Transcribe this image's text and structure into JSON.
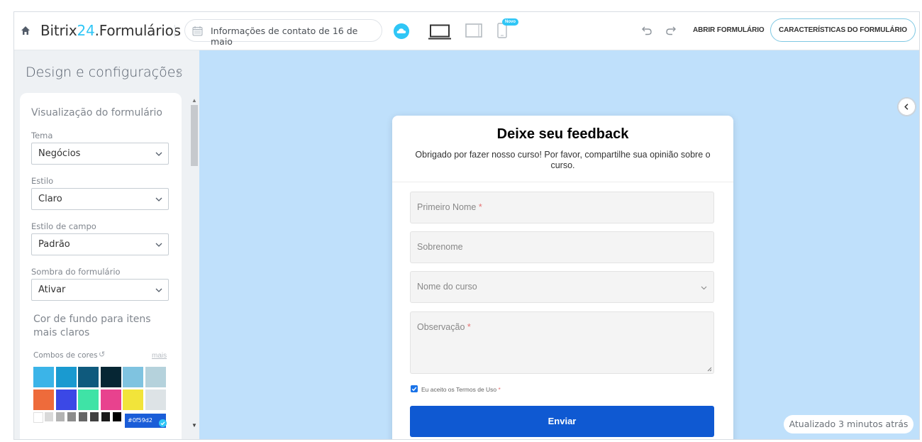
{
  "app": {
    "brand_name": "Bitrix",
    "brand_number": "24",
    "brand_suffix": ".Formulários",
    "accent_color": "#2fc6f6"
  },
  "toolbar": {
    "form_name": "Informações de contato de 16 de maio",
    "new_badge": "Novo",
    "open_form_label": "ABRIR FORMULÁRIO",
    "features_label": "CARACTERÍSTICAS DO FORMULÁRIO",
    "icons": [
      "home-icon",
      "calendar-icon",
      "cloud-icon",
      "desktop-icon",
      "tablet-icon",
      "mobile-icon",
      "undo-icon",
      "redo-icon"
    ]
  },
  "panel": {
    "title": "Design e configurações",
    "close_symbol": "×",
    "preview_heading": "Visualização do formulário",
    "fields": [
      {
        "label": "Tema",
        "value": "Negócios"
      },
      {
        "label": "Estilo",
        "value": "Claro"
      },
      {
        "label": "Estilo de campo",
        "value": "Padrão"
      },
      {
        "label": "Sombra do formulário",
        "value": "Ativar"
      }
    ],
    "background_color_label": "Cor de fundo para itens mais claros",
    "combos_label": "Combos de cores",
    "more_label": "mais",
    "swatches": [
      "#3bb4e8",
      "#1a9ad0",
      "#0f5a7d",
      "#062634",
      "#7fc3e0",
      "#b5d2dc",
      "#ee6b3b",
      "#3b48e6",
      "#3fe3a6",
      "#e8428e",
      "#f2e43a",
      "#dde3e6"
    ],
    "grays": [
      "#ffffff",
      "#d9d9d9",
      "#b3b3b3",
      "#8c8c8c",
      "#666666",
      "#404040",
      "#1a1a1a",
      "#000000"
    ],
    "selected_hex": "#0f59d2"
  },
  "form": {
    "title": "Deixe seu feedback",
    "subtitle": "Obrigado por fazer nosso curso! Por favor, compartilhe sua opinião sobre o curso.",
    "fields": [
      {
        "placeholder": "Primeiro Nome",
        "required": "*"
      },
      {
        "placeholder": "Sobrenome",
        "required": ""
      },
      {
        "placeholder": "Nome do curso",
        "required": ""
      },
      {
        "placeholder": "Observação",
        "required": "*"
      }
    ],
    "terms_label": "Eu aceito os Termos de Uso",
    "terms_required": "*",
    "submit_label": "Enviar",
    "button_color": "#0f59d2"
  },
  "status": {
    "updated_text": "Atualizado 3 minutos atrás"
  },
  "preview_background": "#bfe0fb"
}
